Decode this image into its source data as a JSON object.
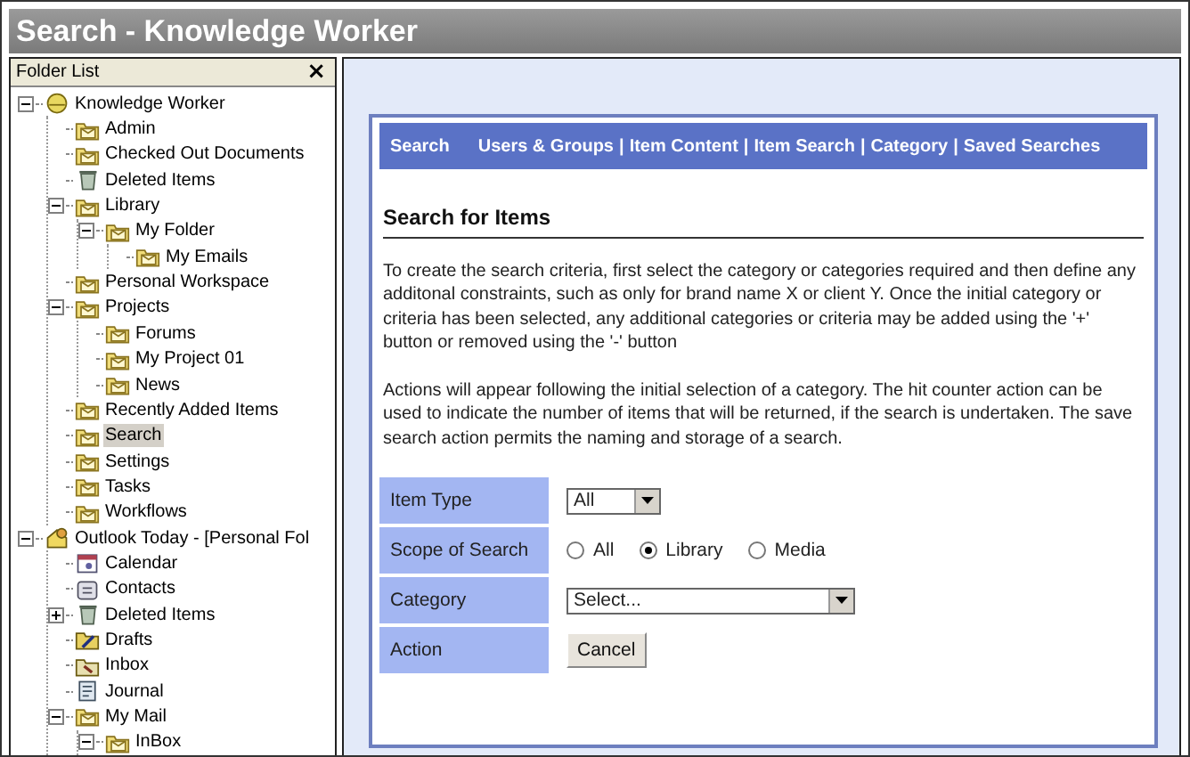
{
  "window": {
    "title": "Search - Knowledge Worker"
  },
  "folder_list": {
    "title": "Folder List",
    "close": "×",
    "tree": [
      {
        "label": "Knowledge Worker",
        "kind": "root",
        "expanded": true,
        "selected": false,
        "children": [
          {
            "label": "Admin",
            "kind": "folder",
            "selected": false
          },
          {
            "label": "Checked Out Documents",
            "kind": "folder",
            "selected": false
          },
          {
            "label": "Deleted Items",
            "kind": "trash",
            "selected": false
          },
          {
            "label": "Library",
            "kind": "folder",
            "expanded": true,
            "selected": false,
            "children": [
              {
                "label": "My Folder",
                "kind": "folder",
                "expanded": true,
                "selected": false,
                "children": [
                  {
                    "label": "My Emails",
                    "kind": "folder",
                    "selected": false
                  }
                ]
              }
            ]
          },
          {
            "label": "Personal Workspace",
            "kind": "folder",
            "selected": false
          },
          {
            "label": "Projects",
            "kind": "folder",
            "expanded": true,
            "selected": false,
            "children": [
              {
                "label": "Forums",
                "kind": "folder",
                "selected": false
              },
              {
                "label": "My Project 01",
                "kind": "folder",
                "selected": false
              },
              {
                "label": "News",
                "kind": "folder",
                "selected": false
              }
            ]
          },
          {
            "label": "Recently Added Items",
            "kind": "folder",
            "selected": false
          },
          {
            "label": "Search",
            "kind": "folder",
            "selected": true
          },
          {
            "label": "Settings",
            "kind": "folder",
            "selected": false
          },
          {
            "label": "Tasks",
            "kind": "folder",
            "selected": false
          },
          {
            "label": "Workflows",
            "kind": "folder",
            "selected": false
          }
        ]
      },
      {
        "label": "Outlook Today - [Personal Fol",
        "kind": "outlook",
        "expanded": true,
        "selected": false,
        "children": [
          {
            "label": "Calendar",
            "kind": "calendar",
            "selected": false
          },
          {
            "label": "Contacts",
            "kind": "contacts",
            "selected": false
          },
          {
            "label": "Deleted Items",
            "kind": "trash",
            "expanded": false,
            "selected": false
          },
          {
            "label": "Drafts",
            "kind": "drafts",
            "selected": false
          },
          {
            "label": "Inbox",
            "kind": "inbox",
            "selected": false
          },
          {
            "label": "Journal",
            "kind": "journal",
            "selected": false
          },
          {
            "label": "My Mail",
            "kind": "folder",
            "expanded": true,
            "selected": false,
            "children": [
              {
                "label": "InBox",
                "kind": "folder",
                "expanded": true,
                "selected": false
              }
            ]
          }
        ]
      }
    ]
  },
  "main": {
    "nav": {
      "section": "Search",
      "links": [
        {
          "label": "Users & Groups",
          "separator": "|"
        },
        {
          "label": "Item Content",
          "separator": "|"
        },
        {
          "label": "Item Search",
          "separator": "|"
        },
        {
          "label": "Category",
          "separator": "|"
        },
        {
          "label": "Saved Searches"
        }
      ]
    },
    "heading": "Search for Items",
    "paragraphs": [
      "To create the search criteria, first select the category or categories required and then define any additonal constraints, such as only for brand name X or client Y. Once the initial category or criteria has been selected, any additional categories or criteria may be added using the '+' button or removed using the '-' button",
      "Actions will appear following the initial selection of a category. The hit counter action can be used to indicate the number of items that will be returned, if the search is undertaken. The save search action permits the naming and storage of a search."
    ],
    "form": [
      {
        "label": "Item Type",
        "kind": "select",
        "value": "All"
      },
      {
        "label": "Scope of Search",
        "kind": "radio",
        "options": [
          {
            "label": "All",
            "selected": false
          },
          {
            "label": "Library",
            "selected": true
          },
          {
            "label": "Media",
            "selected": false
          }
        ]
      },
      {
        "label": "Category",
        "kind": "select",
        "value": "Select...",
        "wide": true
      },
      {
        "label": "Action",
        "kind": "button",
        "value": "Cancel"
      }
    ]
  }
}
